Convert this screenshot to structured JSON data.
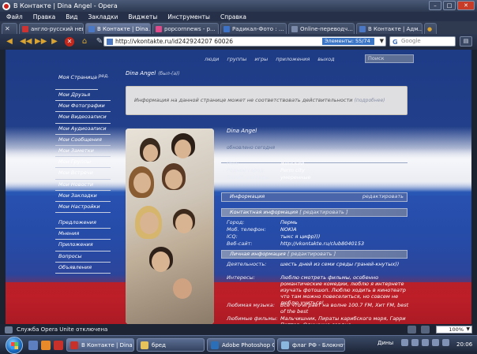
{
  "window": {
    "title": "В Контакте | Dina Angel - Opera"
  },
  "menu": [
    "Файл",
    "Правка",
    "Вид",
    "Закладки",
    "Виджеты",
    "Инструменты",
    "Справка"
  ],
  "tabs": [
    {
      "label": "англо-русский нев..."
    },
    {
      "label": "В Контакте | Dina..."
    },
    {
      "label": "popcornnews - р..."
    },
    {
      "label": "Радикал-Фото : ..."
    },
    {
      "label": "Online-переводч..."
    },
    {
      "label": "В Контакте | Адм..."
    }
  ],
  "nav": {
    "url": "http://vkontakte.ru/id242924207 60026",
    "speed_dial": "Элементы: 55/74",
    "search_placeholder": "Google"
  },
  "page": {
    "topnav": [
      "люди",
      "группы",
      "игры",
      "приложения",
      "выход"
    ],
    "quick_search": "Поиск",
    "left_menu": [
      {
        "label": "Моя Страница",
        "edit": "ред."
      },
      {
        "label": "Мои Друзья"
      },
      {
        "label": "Мои Фотографии"
      },
      {
        "label": "Мои Видеозаписи"
      },
      {
        "label": "Мои Аудиозаписи"
      },
      {
        "label": "Мои Сообщения"
      },
      {
        "label": "Мои Заметки"
      },
      {
        "label": "Мои Группы"
      },
      {
        "label": "Мои Встречи"
      },
      {
        "label": "Мои Новости"
      },
      {
        "label": "Мои Закладки"
      },
      {
        "label": "Мои Настройки"
      }
    ],
    "left_menu_2": [
      {
        "label": "Предложения"
      },
      {
        "label": "Мнения"
      },
      {
        "label": "Приложения"
      },
      {
        "label": "Вопросы"
      },
      {
        "label": "Объявления"
      }
    ],
    "header_name": "Dina Angel",
    "header_status": "(был-(а))",
    "warning": "Информация на данной странице может не соответствовать действительности",
    "warning_more": "(подробнее)",
    "profile_name": "Dina Angel",
    "profile_status": "обновлено сегодня",
    "basic": [
      {
        "k": "Пол:",
        "v": "женский"
      },
      {
        "k": "Родной город:",
        "v": "Perm city"
      },
      {
        "k": "Полит. взгляды:",
        "v": "умеренные"
      }
    ],
    "info_header": "Информация",
    "info_edit": "редактировать",
    "contact_header": "Контактная информация",
    "contact_edit": "[ редактировать ]",
    "contact": [
      {
        "k": "Город:",
        "v": "Пермь"
      },
      {
        "k": "Моб. телефон:",
        "v": "NOKIA"
      },
      {
        "k": "ICQ:",
        "v": "тыкс я цифр)))"
      },
      {
        "k": "Веб-сайт:",
        "v": "http://vkontakte.ru/club8040153"
      }
    ],
    "personal_header": "Личная информация",
    "personal_edit": "[ редактировать ]",
    "personal": [
      {
        "k": "Деятельность:",
        "v": "шесть дней из семи среды граней-кнутых))"
      },
      {
        "k": "Интересы:",
        "v": "Люблю смотреть фильмы, особенно романтические комедии, люблю я интернете изучать фотошоп. Люблю ходить в кинотеатр что там можно повеселиться, но совсем не люблю учиться!"
      },
      {
        "k": "Любимая музыка:",
        "v": "Все что играет на волне 100.7 FM, Хит FM, best of the best"
      },
      {
        "k": "Любимые фильмы:",
        "v": "Мальчишник, Пираты карибского моря, Гарри Поттер, Одинокие сердца"
      }
    ]
  },
  "status_bar": {
    "text": "Служба Opera Unite отключена",
    "zoom": "100%"
  },
  "taskbar": {
    "tasks": [
      {
        "label": "В Контакте | Dina A..."
      },
      {
        "label": "бред"
      },
      {
        "label": "Adobe Photoshop C..."
      },
      {
        "label": "флаг РФ - Блокнот"
      }
    ],
    "lang": "Дины",
    "clock": "20:06"
  }
}
